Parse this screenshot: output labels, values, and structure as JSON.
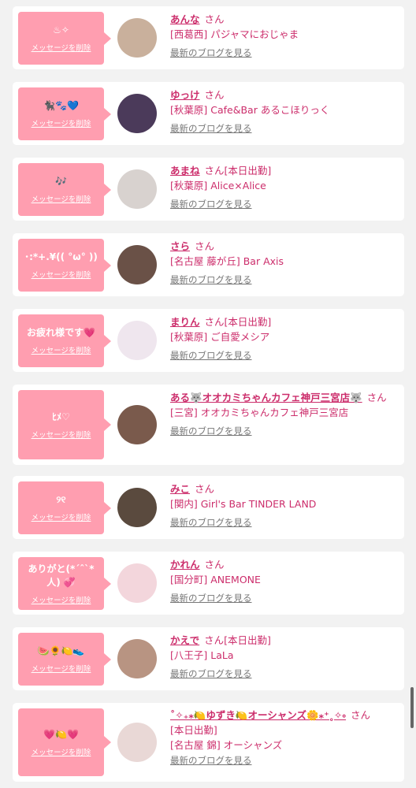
{
  "delete_label": "メッセージを削除",
  "blog_label": "最新のブログを見る",
  "honorific": "さん",
  "items": [
    {
      "message": "♨︎✧",
      "name": "あんな",
      "status": "",
      "area": "[西葛西]",
      "shop": "パジャマにおじゃま",
      "avatar_color": "#c9b09c"
    },
    {
      "message": "🐈‍⬛🐾💙",
      "name": "ゆっけ",
      "status": "",
      "area": "[秋葉原]",
      "shop": "Cafe&Bar あるこほりっく",
      "avatar_color": "#4b3a5a"
    },
    {
      "message": "🎶",
      "name": "あまね",
      "status": "[本日出勤]",
      "area": "[秋葉原]",
      "shop": "Alice×Alice",
      "avatar_color": "#d8d2cf"
    },
    {
      "message": "･:*+.¥(( °ω° ))",
      "name": "さら",
      "status": "",
      "area": "[名古屋 藤が丘]",
      "shop": "Bar Axis",
      "avatar_color": "#6a5147"
    },
    {
      "message": "お疲れ様です💗",
      "name": "まりん",
      "status": "[本日出勤]",
      "area": "[秋葉原]",
      "shop": "ご自愛メシア",
      "avatar_color": "#efe6ee"
    },
    {
      "message": "ﾋﾒ♡",
      "name": "ある🐺オオカミちゃんカフェ神戸三宮店🐺",
      "status": "",
      "area": "[三宮]",
      "shop": "オオカミちゃんカフェ神戸三宮店",
      "avatar_color": "#7a5a4c"
    },
    {
      "message": "୨୧",
      "name": "みこ",
      "status": "",
      "area": "[関内]",
      "shop": "Girl's Bar TINDER LAND",
      "avatar_color": "#5a4a3e"
    },
    {
      "message": "ありがと(*´ˆ`*人) 💞",
      "name": "かれん",
      "status": "",
      "area": "[国分町]",
      "shop": "ANEMONE",
      "avatar_color": "#f3d6dc"
    },
    {
      "message": "🍉🌻🍋👟",
      "name": "かえで",
      "status": "[本日出勤]",
      "area": "[八王子]",
      "shop": "LaLa",
      "avatar_color": "#b89482"
    },
    {
      "message": "💗🍋💗",
      "name": "˚✧₊⁎🍋ゆずき🍋オーシャンズ🌼⁎⁺˳✧༚",
      "status": "[本日出勤]",
      "area": "[名古屋 錦]",
      "shop": "オーシャンズ",
      "avatar_color": "#e9d8d6"
    }
  ]
}
